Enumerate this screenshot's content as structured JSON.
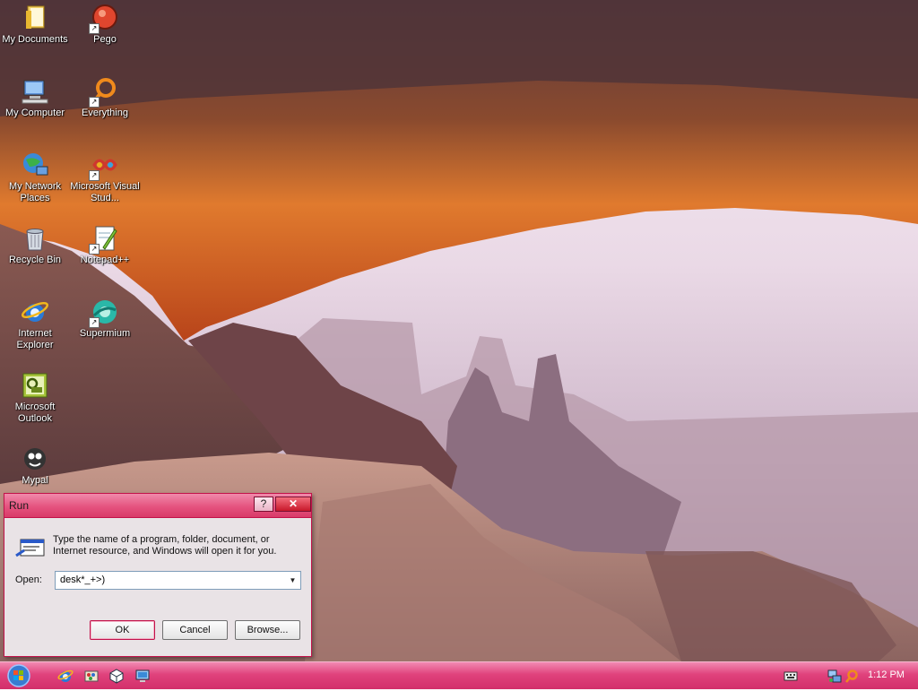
{
  "desktop_icons": [
    {
      "label": "My Documents",
      "icon": "folder-icon"
    },
    {
      "label": "Pego",
      "icon": "pego-icon"
    },
    {
      "label": "My Computer",
      "icon": "computer-icon"
    },
    {
      "label": "Everything",
      "icon": "everything-icon"
    },
    {
      "label": "My Network Places",
      "icon": "network-icon"
    },
    {
      "label": "Microsoft Visual Stud...",
      "icon": "visual-studio-icon"
    },
    {
      "label": "Recycle Bin",
      "icon": "recycle-bin-icon"
    },
    {
      "label": "Notepad++",
      "icon": "notepad-plus-plus-icon"
    },
    {
      "label": "Internet Explorer",
      "icon": "internet-explorer-icon"
    },
    {
      "label": "Supermium",
      "icon": "supermium-icon"
    },
    {
      "label": "Microsoft Outlook",
      "icon": "outlook-icon"
    },
    {
      "label": "Mypal",
      "icon": "mypal-icon"
    }
  ],
  "run_dialog": {
    "title": "Run",
    "help_label": "?",
    "close_label": "✕",
    "description": "Type the name of a program, folder, document, or Internet resource, and Windows will open it for you.",
    "open_label": "Open:",
    "open_value": "desk*_+>)",
    "ok_label": "OK",
    "cancel_label": "Cancel",
    "browse_label": "Browse..."
  },
  "taskbar": {
    "clock": "1:12 PM",
    "quick_launch": [
      "internet-explorer-icon",
      "paint-icon",
      "cube-icon",
      "network-icon"
    ],
    "tray": [
      "keyboard-icon",
      "network-tray-icon",
      "search-tray-icon"
    ]
  },
  "colors": {
    "taskbar": "#e0427c",
    "dialog_border": "#c2124a",
    "dialog_bg": "#e9e3e6"
  }
}
